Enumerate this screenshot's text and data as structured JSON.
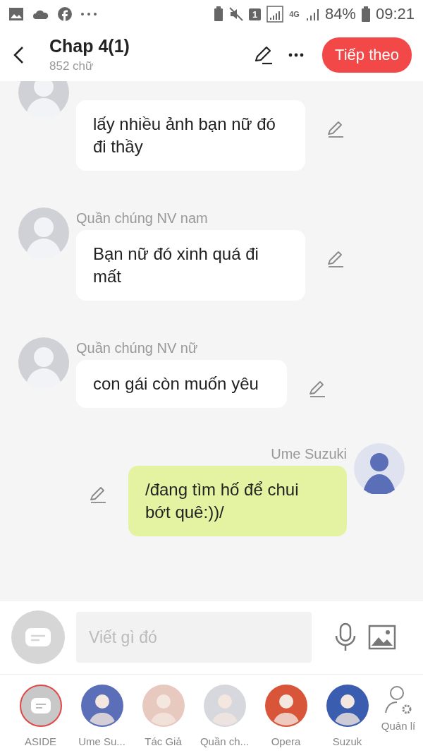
{
  "status_bar": {
    "sim": "1",
    "network": "4G",
    "battery": "84%",
    "time": "09:21"
  },
  "header": {
    "title": "Chap 4(1)",
    "word_count": "852 chữ",
    "next_button": "Tiếp theo"
  },
  "messages": [
    {
      "kind": "left",
      "text": "lấy nhiều ảnh bạn nữ đó đi thầy"
    },
    {
      "kind": "left",
      "name": "Quần chúng NV nam",
      "text": "Bạn nữ đó xinh quá đi mất"
    },
    {
      "kind": "left",
      "name": "Quần chúng NV nữ",
      "text": "con gái còn muốn yêu"
    },
    {
      "kind": "right",
      "name": "Ume Suzuki",
      "text": "/đang tìm hố để chui bớt quê:))/"
    }
  ],
  "composer": {
    "placeholder": "Viết gì đó"
  },
  "characters": [
    {
      "kind": "aside",
      "label": "ASIDE",
      "selected": true
    },
    {
      "kind": "avatar",
      "label": "Ume Su...",
      "selected": false
    },
    {
      "kind": "avatar",
      "label": "Tác Giả",
      "selected": false
    },
    {
      "kind": "avatar",
      "label": "Quần ch...",
      "selected": false
    },
    {
      "kind": "avatar",
      "label": "Opera",
      "selected": false
    },
    {
      "kind": "avatar",
      "label": "Suzuk",
      "selected": false
    }
  ],
  "manage_button": "Quản lí"
}
